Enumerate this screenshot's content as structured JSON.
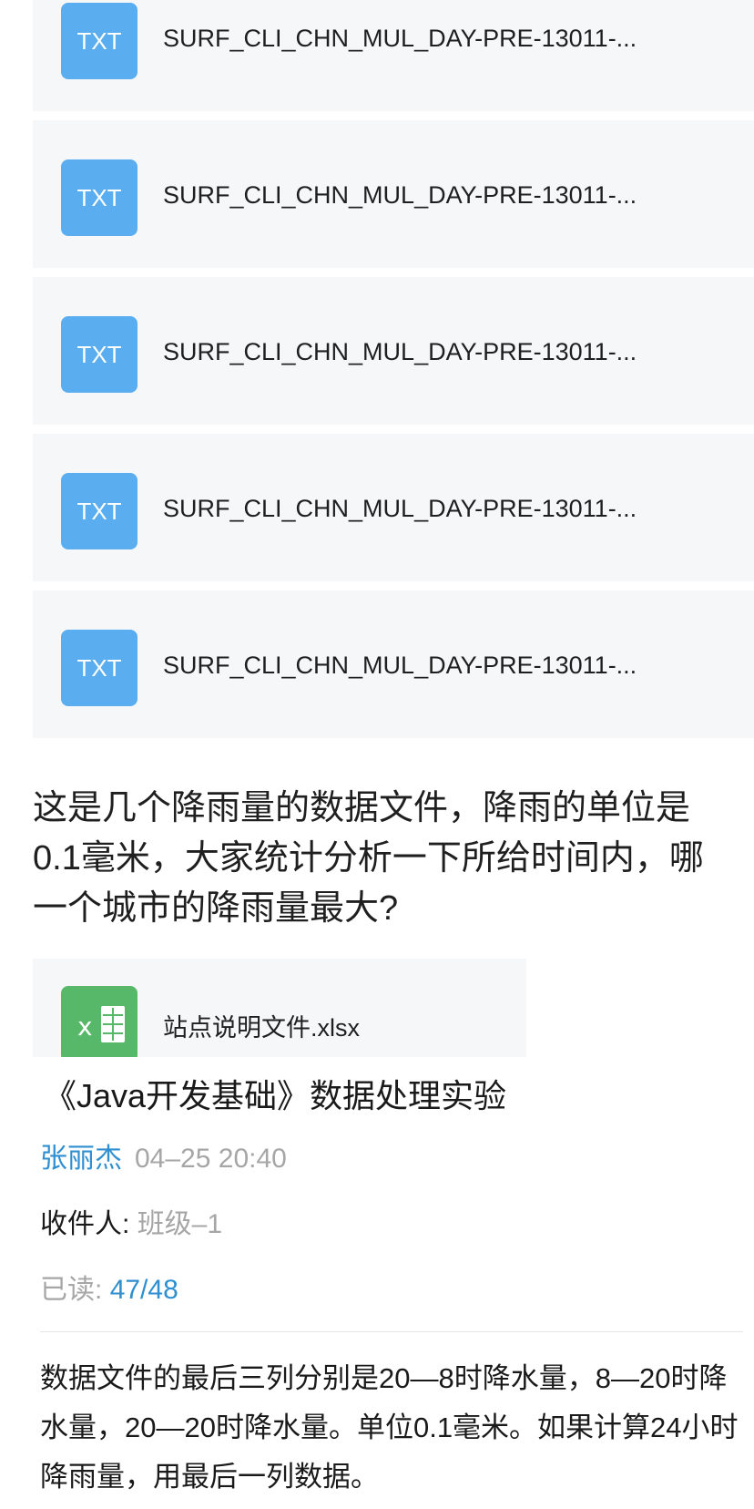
{
  "attachments": [
    {
      "type": "TXT",
      "name": "SURF_CLI_CHN_MUL_DAY-PRE-13011-..."
    },
    {
      "type": "TXT",
      "name": "SURF_CLI_CHN_MUL_DAY-PRE-13011-..."
    },
    {
      "type": "TXT",
      "name": "SURF_CLI_CHN_MUL_DAY-PRE-13011-..."
    },
    {
      "type": "TXT",
      "name": "SURF_CLI_CHN_MUL_DAY-PRE-13011-..."
    },
    {
      "type": "TXT",
      "name": "SURF_CLI_CHN_MUL_DAY-PRE-13011-..."
    }
  ],
  "description": "这是几个降雨量的数据文件，降雨的单位是0.1毫米，大家统计分析一下所给时间内，哪一个城市的降雨量最大?",
  "extra_attachment": {
    "name": "站点说明文件.xlsx",
    "icon": "excel-icon"
  },
  "post": {
    "title": "《Java开发基础》数据处理实验",
    "author": "张丽杰",
    "time": "04–25 20:40",
    "recipient_label": "收件人:",
    "recipient_value": "班级–1",
    "read_label": "已读:",
    "read_value": "47/48",
    "note": "数据文件的最后三列分别是20—8时降水量，8—20时降水量，20—20时降水量。单位0.1毫米。如果计算24小时降雨量，用最后一列数据。"
  },
  "colors": {
    "txt_icon": "#5aaef0",
    "excel_icon": "#58b86a",
    "link": "#2f8fd1",
    "muted": "#a6a6a6"
  }
}
